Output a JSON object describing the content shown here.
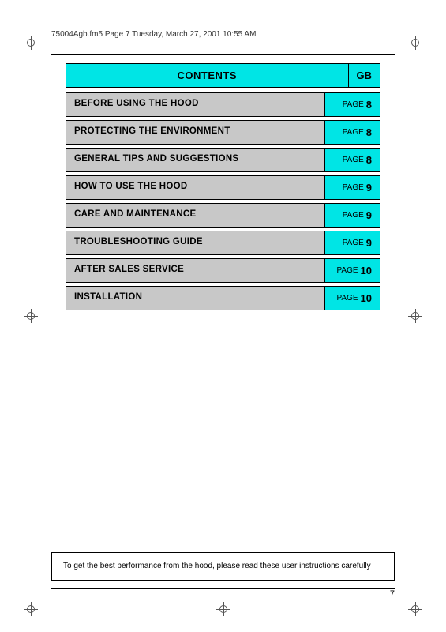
{
  "header": {
    "filename": "75004Agb.fm5  Page 7  Tuesday, March 27, 2001  10:55 AM"
  },
  "contents": {
    "title": "CONTENTS",
    "gb_label": "GB",
    "rows": [
      {
        "label": "BEFORE USING THE HOOD",
        "page_word": "PAGE",
        "page_num": "8"
      },
      {
        "label": "PROTECTING THE ENVIRONMENT",
        "page_word": "PAGE",
        "page_num": "8"
      },
      {
        "label": "GENERAL TIPS AND SUGGESTIONS",
        "page_word": "PAGE",
        "page_num": "8"
      },
      {
        "label": "HOW TO USE THE HOOD",
        "page_word": "PAGE",
        "page_num": "9"
      },
      {
        "label": "CARE AND MAINTENANCE",
        "page_word": "PAGE",
        "page_num": "9"
      },
      {
        "label": "TROUBLESHOOTING GUIDE",
        "page_word": "PAGE",
        "page_num": "9"
      },
      {
        "label": "AFTER SALES SERVICE",
        "page_word": "PAGE",
        "page_num": "10"
      },
      {
        "label": "INSTALLATION",
        "page_word": "PAGE",
        "page_num": "10"
      }
    ]
  },
  "footer": {
    "note": "To get the best performance from the hood, please read these user instructions carefully",
    "page_number": "7"
  }
}
